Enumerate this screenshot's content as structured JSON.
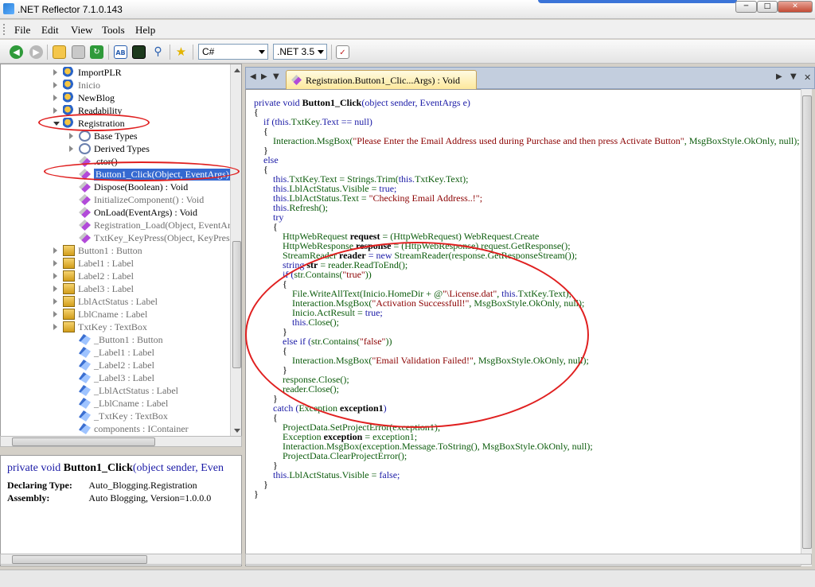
{
  "window": {
    "title": ".NET Reflector 7.1.0.143"
  },
  "menu": {
    "items": [
      "File",
      "Edit",
      "View",
      "Tools",
      "Help"
    ]
  },
  "toolbar": {
    "language": "C#",
    "framework": ".NET 3.5"
  },
  "tree": {
    "rows": [
      {
        "label": "ImportPLR",
        "icon": "namespace-icon",
        "indent": 1,
        "expander": "collapsed",
        "gray": false
      },
      {
        "label": "Inicio",
        "icon": "namespace-icon",
        "indent": 1,
        "expander": "collapsed",
        "gray": true
      },
      {
        "label": "NewBlog",
        "icon": "namespace-icon",
        "indent": 1,
        "expander": "collapsed",
        "gray": false
      },
      {
        "label": "Readability",
        "icon": "namespace-icon",
        "indent": 1,
        "expander": "collapsed",
        "gray": false
      },
      {
        "label": "Registration",
        "icon": "namespace-icon",
        "indent": 1,
        "expander": "expanded",
        "gray": false
      },
      {
        "label": "Base Types",
        "icon": "base-types-icon",
        "indent": 2,
        "expander": "collapsed",
        "gray": false
      },
      {
        "label": "Derived Types",
        "icon": "derived-types-icon",
        "indent": 2,
        "expander": "collapsed",
        "gray": false
      },
      {
        "label": ".ctor()",
        "icon": "constructor-icon",
        "indent": 2,
        "expander": "none",
        "gray": false
      },
      {
        "label": "Button1_Click(Object, EventArgs)",
        "icon": "method-icon",
        "indent": 2,
        "expander": "none",
        "gray": false,
        "selected": true
      },
      {
        "label": "Dispose(Boolean) : Void",
        "icon": "method-icon",
        "indent": 2,
        "expander": "none",
        "gray": false
      },
      {
        "label": "InitializeComponent() : Void",
        "icon": "method-icon",
        "indent": 2,
        "expander": "none",
        "gray": true
      },
      {
        "label": "OnLoad(EventArgs) : Void",
        "icon": "method-icon",
        "indent": 2,
        "expander": "none",
        "gray": false
      },
      {
        "label": "Registration_Load(Object, EventAr",
        "icon": "method-icon",
        "indent": 2,
        "expander": "none",
        "gray": true
      },
      {
        "label": "TxtKey_KeyPress(Object, KeyPress",
        "icon": "method-icon",
        "indent": 2,
        "expander": "none",
        "gray": true
      },
      {
        "label": "Button1 : Button",
        "icon": "property-icon",
        "indent": 1,
        "expander": "collapsed",
        "gray": true
      },
      {
        "label": "Label1 : Label",
        "icon": "property-icon",
        "indent": 1,
        "expander": "collapsed",
        "gray": true
      },
      {
        "label": "Label2 : Label",
        "icon": "property-icon",
        "indent": 1,
        "expander": "collapsed",
        "gray": true
      },
      {
        "label": "Label3 : Label",
        "icon": "property-icon",
        "indent": 1,
        "expander": "collapsed",
        "gray": true
      },
      {
        "label": "LblActStatus : Label",
        "icon": "property-icon",
        "indent": 1,
        "expander": "collapsed",
        "gray": true
      },
      {
        "label": "LblCname : Label",
        "icon": "property-icon",
        "indent": 1,
        "expander": "collapsed",
        "gray": true
      },
      {
        "label": "TxtKey : TextBox",
        "icon": "property-icon",
        "indent": 1,
        "expander": "collapsed",
        "gray": true
      },
      {
        "label": "_Button1 : Button",
        "icon": "field-icon",
        "indent": 2,
        "expander": "none",
        "gray": true
      },
      {
        "label": "_Label1 : Label",
        "icon": "field-icon",
        "indent": 2,
        "expander": "none",
        "gray": true
      },
      {
        "label": "_Label2 : Label",
        "icon": "field-icon",
        "indent": 2,
        "expander": "none",
        "gray": true
      },
      {
        "label": "_Label3 : Label",
        "icon": "field-icon",
        "indent": 2,
        "expander": "none",
        "gray": true
      },
      {
        "label": "_LblActStatus : Label",
        "icon": "field-icon",
        "indent": 2,
        "expander": "none",
        "gray": true
      },
      {
        "label": "_LblCname : Label",
        "icon": "field-icon",
        "indent": 2,
        "expander": "none",
        "gray": true
      },
      {
        "label": "_TxtKey : TextBox",
        "icon": "field-icon",
        "indent": 2,
        "expander": "none",
        "gray": true
      },
      {
        "label": "components : IContainer",
        "icon": "field-icon",
        "indent": 2,
        "expander": "none",
        "gray": true
      }
    ]
  },
  "details": {
    "signature": [
      {
        "t": "private void ",
        "c": "kw"
      },
      {
        "t": "Button1_Click",
        "c": "bold"
      },
      {
        "t": "(object sender, Even",
        "c": "kw"
      }
    ],
    "declaring_type_label": "Declaring Type:",
    "declaring_type_value": "Auto_Blogging.Registration",
    "assembly_label": "Assembly:",
    "assembly_value": "Auto Blogging, Version=1.0.0.0"
  },
  "document_tab": {
    "label": "Registration.Button1_Clic...Args) : Void"
  },
  "code": [
    [
      {
        "t": "private void ",
        "c": "kw"
      },
      {
        "t": "Button1_Click",
        "c": "bold"
      },
      {
        "t": "(object sender, EventArgs e)",
        "c": "kw"
      }
    ],
    [
      {
        "t": "{",
        "c": "plain"
      }
    ],
    [
      {
        "t": "    if (this.",
        "c": "kw"
      },
      {
        "t": "TxtKey",
        "c": "id"
      },
      {
        "t": ".Text == null)",
        "c": "kw"
      }
    ],
    [
      {
        "t": "    {",
        "c": "plain"
      }
    ],
    [
      {
        "t": "        ",
        "c": "plain"
      },
      {
        "t": "Interaction.MsgBox(",
        "c": "id"
      },
      {
        "t": "\"Please Enter the Email Address used during Purchase and then press Activate Button\"",
        "c": "str"
      },
      {
        "t": ", MsgBoxStyle.OkOnly, null);",
        "c": "id"
      }
    ],
    [
      {
        "t": "    }",
        "c": "plain"
      }
    ],
    [
      {
        "t": "    else",
        "c": "kw"
      }
    ],
    [
      {
        "t": "    {",
        "c": "plain"
      }
    ],
    [
      {
        "t": "        this.",
        "c": "kw"
      },
      {
        "t": "TxtKey.Text = Strings.Trim(",
        "c": "id"
      },
      {
        "t": "this.",
        "c": "kw"
      },
      {
        "t": "TxtKey.Text);",
        "c": "id"
      }
    ],
    [
      {
        "t": "        this.",
        "c": "kw"
      },
      {
        "t": "LblActStatus.Visible = ",
        "c": "id"
      },
      {
        "t": "true;",
        "c": "kw"
      }
    ],
    [
      {
        "t": "        this.",
        "c": "kw"
      },
      {
        "t": "LblActStatus.Text = ",
        "c": "id"
      },
      {
        "t": "\"Checking Email Address..!\";",
        "c": "str"
      }
    ],
    [
      {
        "t": "        this.",
        "c": "kw"
      },
      {
        "t": "Refresh();",
        "c": "id"
      }
    ],
    [
      {
        "t": "        try",
        "c": "kw"
      }
    ],
    [
      {
        "t": "        {",
        "c": "plain"
      }
    ],
    [
      {
        "t": "            ",
        "c": "plain"
      },
      {
        "t": "HttpWebRequest ",
        "c": "id"
      },
      {
        "t": "request",
        "c": "bold"
      },
      {
        "t": " = (HttpWebRequest) WebRequest.Create",
        "c": "id"
      }
    ],
    [
      {
        "t": "            ",
        "c": "plain"
      },
      {
        "t": "HttpWebResponse ",
        "c": "id"
      },
      {
        "t": "response",
        "c": "bold"
      },
      {
        "t": " = (HttpWebResponse) request.GetResponse();",
        "c": "id"
      }
    ],
    [
      {
        "t": "            ",
        "c": "plain"
      },
      {
        "t": "StreamReader ",
        "c": "id"
      },
      {
        "t": "reader",
        "c": "bold"
      },
      {
        "t": " = new ",
        "c": "kw"
      },
      {
        "t": "StreamReader(response.GetResponseStream());",
        "c": "id"
      }
    ],
    [
      {
        "t": "            string ",
        "c": "kw"
      },
      {
        "t": "str",
        "c": "bold"
      },
      {
        "t": " = reader.ReadToEnd();",
        "c": "id"
      }
    ],
    [
      {
        "t": "            if (",
        "c": "kw"
      },
      {
        "t": "str.Contains(",
        "c": "id"
      },
      {
        "t": "\"true\"",
        "c": "str"
      },
      {
        "t": "))",
        "c": "id"
      }
    ],
    [
      {
        "t": "            {",
        "c": "plain"
      }
    ],
    [
      {
        "t": "                ",
        "c": "plain"
      },
      {
        "t": "File.WriteAllText(Inicio.HomeDir + @",
        "c": "id"
      },
      {
        "t": "\"\\License.dat\"",
        "c": "str"
      },
      {
        "t": ", ",
        "c": "id"
      },
      {
        "t": "this.",
        "c": "kw"
      },
      {
        "t": "TxtKey.Text);",
        "c": "id"
      }
    ],
    [
      {
        "t": "                ",
        "c": "plain"
      },
      {
        "t": "Interaction.MsgBox(",
        "c": "id"
      },
      {
        "t": "\"Activation Successfull!\"",
        "c": "str"
      },
      {
        "t": ", MsgBoxStyle.OkOnly, null);",
        "c": "id"
      }
    ],
    [
      {
        "t": "                ",
        "c": "plain"
      },
      {
        "t": "Inicio.ActResult = ",
        "c": "id"
      },
      {
        "t": "true;",
        "c": "kw"
      }
    ],
    [
      {
        "t": "                this.",
        "c": "kw"
      },
      {
        "t": "Close();",
        "c": "id"
      }
    ],
    [
      {
        "t": "            }",
        "c": "plain"
      }
    ],
    [
      {
        "t": "            else if (",
        "c": "kw"
      },
      {
        "t": "str.Contains(",
        "c": "id"
      },
      {
        "t": "\"false\"",
        "c": "str"
      },
      {
        "t": "))",
        "c": "id"
      }
    ],
    [
      {
        "t": "            {",
        "c": "plain"
      }
    ],
    [
      {
        "t": "                ",
        "c": "plain"
      },
      {
        "t": "Interaction.MsgBox(",
        "c": "id"
      },
      {
        "t": "\"Email Validation Failed!\"",
        "c": "str"
      },
      {
        "t": ", MsgBoxStyle.OkOnly, null);",
        "c": "id"
      }
    ],
    [
      {
        "t": "            }",
        "c": "plain"
      }
    ],
    [
      {
        "t": "            ",
        "c": "plain"
      },
      {
        "t": "response.Close();",
        "c": "id"
      }
    ],
    [
      {
        "t": "            ",
        "c": "plain"
      },
      {
        "t": "reader.Close();",
        "c": "id"
      }
    ],
    [
      {
        "t": "        }",
        "c": "plain"
      }
    ],
    [
      {
        "t": "        catch (",
        "c": "kw"
      },
      {
        "t": "Exception ",
        "c": "id"
      },
      {
        "t": "exception1",
        "c": "bold"
      },
      {
        "t": ")",
        "c": "kw"
      }
    ],
    [
      {
        "t": "        {",
        "c": "plain"
      }
    ],
    [
      {
        "t": "            ",
        "c": "plain"
      },
      {
        "t": "ProjectData.SetProjectError(exception1);",
        "c": "id"
      }
    ],
    [
      {
        "t": "            ",
        "c": "plain"
      },
      {
        "t": "Exception ",
        "c": "id"
      },
      {
        "t": "exception",
        "c": "bold"
      },
      {
        "t": " = exception1;",
        "c": "id"
      }
    ],
    [
      {
        "t": "            ",
        "c": "plain"
      },
      {
        "t": "Interaction.MsgBox(exception.Message.ToString(), MsgBoxStyle.OkOnly, null);",
        "c": "id"
      }
    ],
    [
      {
        "t": "            ",
        "c": "plain"
      },
      {
        "t": "ProjectData.ClearProjectError();",
        "c": "id"
      }
    ],
    [
      {
        "t": "        }",
        "c": "plain"
      }
    ],
    [
      {
        "t": "        this.",
        "c": "kw"
      },
      {
        "t": "LblActStatus.Visible = ",
        "c": "id"
      },
      {
        "t": "false;",
        "c": "kw"
      }
    ],
    [
      {
        "t": "    }",
        "c": "plain"
      }
    ],
    [
      {
        "t": "}",
        "c": "plain"
      }
    ]
  ],
  "colors": {
    "annotation": "#e02020",
    "selection": "#3469d1",
    "keyword": "#1a1aa6",
    "string": "#8b0000",
    "identifier": "#0b5b0b"
  }
}
